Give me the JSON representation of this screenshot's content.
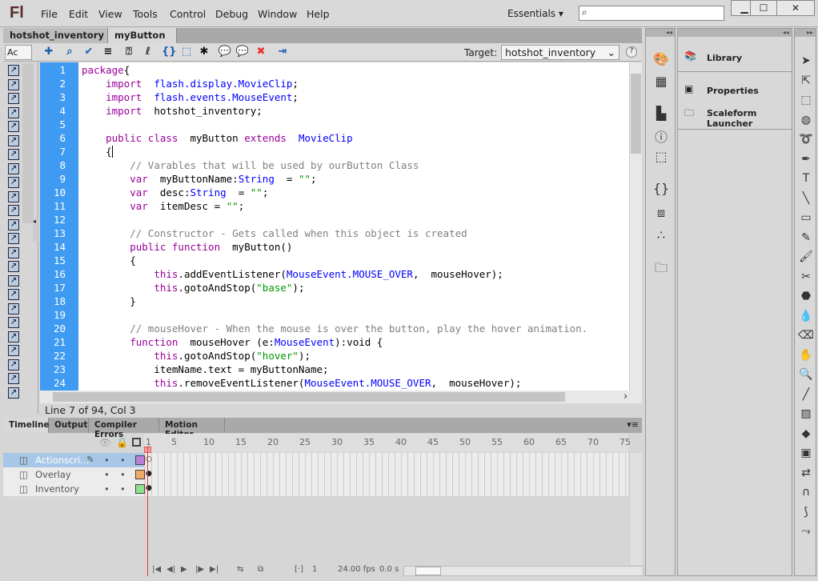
{
  "app": {
    "logo": "Fl",
    "menu": [
      "File",
      "Edit",
      "View",
      "Tools",
      "Control",
      "Debug",
      "Window",
      "Help"
    ],
    "workspace": "Essentials",
    "search_placeholder": ""
  },
  "window_controls": {
    "minimize": "▁",
    "maximize": "☐",
    "close": "✕"
  },
  "doc_tabs": [
    {
      "label": "hotshot_inventory",
      "close": "×"
    },
    {
      "label": "myButton",
      "close": "×",
      "active": true
    }
  ],
  "toolbar": {
    "script_nav": "Ac",
    "target_label": "Target:",
    "target_value": "hotshot_inventory",
    "help": "?",
    "icons": [
      "add-statement-icon",
      "find-icon",
      "check-syntax-icon",
      "auto-format-icon",
      "code-hint-icon",
      "debug-options-icon",
      "collapse-braces-icon",
      "collapse-selection-icon",
      "expand-all-icon",
      "block-comment-icon",
      "line-comment-icon",
      "remove-comment-icon",
      "script-assist-icon"
    ]
  },
  "code": {
    "lines": [
      [
        [
          "kw",
          "package"
        ],
        [
          "",
          "{"
        ]
      ],
      [
        [
          "",
          "    "
        ],
        [
          "kw",
          "import"
        ],
        [
          "",
          "  "
        ],
        [
          "cls",
          "flash.display.MovieClip"
        ],
        [
          "",
          ";"
        ]
      ],
      [
        [
          "",
          "    "
        ],
        [
          "kw",
          "import"
        ],
        [
          "",
          "  "
        ],
        [
          "cls",
          "flash.events.MouseEvent"
        ],
        [
          "",
          ";"
        ]
      ],
      [
        [
          "",
          "    "
        ],
        [
          "kw",
          "import"
        ],
        [
          "",
          "  hotshot_inventory;"
        ]
      ],
      [],
      [
        [
          "",
          "    "
        ],
        [
          "kw",
          "public class"
        ],
        [
          "",
          "  myButton "
        ],
        [
          "kw",
          "extends"
        ],
        [
          "",
          "  "
        ],
        [
          "cls",
          "MovieClip"
        ]
      ],
      [
        [
          "",
          "    {"
        ]
      ],
      [
        [
          "",
          "        "
        ],
        [
          "cm",
          "// Varables that will be used by ourButton Class"
        ]
      ],
      [
        [
          "",
          "        "
        ],
        [
          "kw",
          "var"
        ],
        [
          "",
          "  myButtonName:"
        ],
        [
          "cls",
          "String"
        ],
        [
          "",
          ""
        ],
        [
          "",
          "  = "
        ],
        [
          "str",
          "\"\""
        ],
        [
          "",
          ";"
        ]
      ],
      [
        [
          "",
          "        "
        ],
        [
          "kw",
          "var"
        ],
        [
          "",
          "  desc:"
        ],
        [
          "cls",
          "String"
        ],
        [
          "",
          "  = "
        ],
        [
          "str",
          "\"\""
        ],
        [
          "",
          ";"
        ]
      ],
      [
        [
          "",
          "        "
        ],
        [
          "kw",
          "var"
        ],
        [
          "",
          "  itemDesc = "
        ],
        [
          "str",
          "\"\""
        ],
        [
          "",
          ";"
        ]
      ],
      [],
      [
        [
          "",
          "        "
        ],
        [
          "cm",
          "// Constructor - Gets called when this object is created"
        ]
      ],
      [
        [
          "",
          "        "
        ],
        [
          "kw",
          "public function"
        ],
        [
          "",
          "  myButton()"
        ]
      ],
      [
        [
          "",
          "        {"
        ]
      ],
      [
        [
          "",
          "            "
        ],
        [
          "kw",
          "this"
        ],
        [
          "",
          ".addEventListener("
        ],
        [
          "cls",
          "MouseEvent.MOUSE_OVER"
        ],
        [
          "",
          ",  mouseHover);"
        ]
      ],
      [
        [
          "",
          "            "
        ],
        [
          "kw",
          "this"
        ],
        [
          "",
          ".gotoAndStop("
        ],
        [
          "str",
          "\"base\""
        ],
        [
          "",
          ");"
        ]
      ],
      [
        [
          "",
          "        }"
        ]
      ],
      [],
      [
        [
          "",
          "        "
        ],
        [
          "cm",
          "// mouseHover - When the mouse is over the button, play the hover animation."
        ]
      ],
      [
        [
          "",
          "        "
        ],
        [
          "kw",
          "function"
        ],
        [
          "",
          "  mouseHover (e:"
        ],
        [
          "cls",
          "MouseEvent"
        ],
        [
          "",
          "):void {"
        ]
      ],
      [
        [
          "",
          "            "
        ],
        [
          "kw",
          "this"
        ],
        [
          "",
          ".gotoAndStop("
        ],
        [
          "str",
          "\"hover\""
        ],
        [
          "",
          ");"
        ]
      ],
      [
        [
          "",
          "            itemName.text = myButtonName;"
        ]
      ],
      [
        [
          "",
          "            "
        ],
        [
          "kw",
          "this"
        ],
        [
          "",
          ".removeEventListener("
        ],
        [
          "cls",
          "MouseEvent.MOUSE_OVER"
        ],
        [
          "",
          ",  mouseHover);"
        ]
      ]
    ],
    "colors": {
      "keyword": "#990099",
      "class": "#0000ff",
      "string": "#009900",
      "comment": "#808080",
      "gutter": "#3f9bf2"
    }
  },
  "status": "Line 7 of 94, Col 3",
  "timeline": {
    "tabs": [
      "Timeline",
      "Output",
      "Compiler Errors",
      "Motion Editor"
    ],
    "ruler": [
      "1",
      "5",
      "10",
      "15",
      "20",
      "25",
      "30",
      "35",
      "40",
      "45",
      "50",
      "55",
      "60",
      "65",
      "70",
      "75"
    ],
    "layers": [
      {
        "name": "Actionscri...",
        "color": "#b77fd6",
        "selected": true
      },
      {
        "name": "Overlay",
        "color": "#f0aa66"
      },
      {
        "name": "Inventory",
        "color": "#8fe08f"
      }
    ],
    "current_frame": "1",
    "fps": "24.00 fps",
    "time": "0.0 s"
  },
  "panels": {
    "items": [
      "Library",
      "Properties",
      "Scaleform Launcher"
    ],
    "collapse": "◂◂",
    "expand": "▸▸"
  }
}
